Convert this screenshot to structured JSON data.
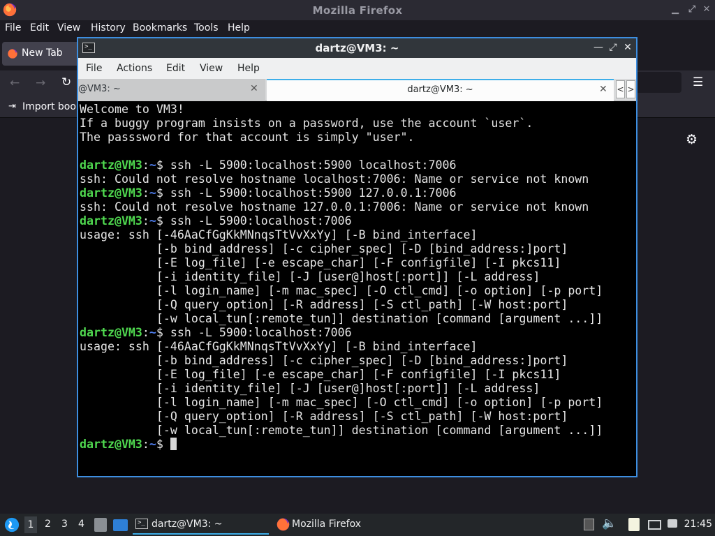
{
  "firefox": {
    "window_title": "Mozilla Firefox",
    "menu": [
      "File",
      "Edit",
      "View",
      "History",
      "Bookmarks",
      "Tools",
      "Help"
    ],
    "tab_title": "New Tab",
    "bookmarks_item": "Import book",
    "colors": {
      "chrome": "#2b2a33",
      "bg": "#1c1b22"
    }
  },
  "terminal": {
    "window_title": "dartz@VM3: ~",
    "menu": [
      "File",
      "Actions",
      "Edit",
      "View",
      "Help"
    ],
    "tabs": [
      {
        "label": "@VM3: ~",
        "active": false
      },
      {
        "label": "dartz@VM3: ~",
        "active": true
      }
    ],
    "prompt": {
      "user": "dartz@VM3",
      "sep": ":",
      "path": "~",
      "symbol": "$ "
    },
    "lines": [
      {
        "type": "text",
        "text": "Welcome to VM3!"
      },
      {
        "type": "text",
        "text": "If a buggy program insists on a password, use the account `user`."
      },
      {
        "type": "text",
        "text": "The passsword for that account is simply \"user\"."
      },
      {
        "type": "text",
        "text": ""
      },
      {
        "type": "prompt",
        "cmd": "ssh -L 5900:localhost:5900 localhost:7006"
      },
      {
        "type": "text",
        "text": "ssh: Could not resolve hostname localhost:7006: Name or service not known"
      },
      {
        "type": "prompt",
        "cmd": "ssh -L 5900:localhost:5900 127.0.0.1:7006"
      },
      {
        "type": "text",
        "text": "ssh: Could not resolve hostname 127.0.0.1:7006: Name or service not known"
      },
      {
        "type": "prompt",
        "cmd": "ssh -L 5900:localhost:7006"
      },
      {
        "type": "text",
        "text": "usage: ssh [-46AaCfGgKkMNnqsTtVvXxYy] [-B bind_interface]"
      },
      {
        "type": "text",
        "text": "           [-b bind_address] [-c cipher_spec] [-D [bind_address:]port]"
      },
      {
        "type": "text",
        "text": "           [-E log_file] [-e escape_char] [-F configfile] [-I pkcs11]"
      },
      {
        "type": "text",
        "text": "           [-i identity_file] [-J [user@]host[:port]] [-L address]"
      },
      {
        "type": "text",
        "text": "           [-l login_name] [-m mac_spec] [-O ctl_cmd] [-o option] [-p port]"
      },
      {
        "type": "text",
        "text": "           [-Q query_option] [-R address] [-S ctl_path] [-W host:port]"
      },
      {
        "type": "text",
        "text": "           [-w local_tun[:remote_tun]] destination [command [argument ...]]"
      },
      {
        "type": "prompt",
        "cmd": "ssh -L 5900:localhost:7006"
      },
      {
        "type": "text",
        "text": "usage: ssh [-46AaCfGgKkMNnqsTtVvXxYy] [-B bind_interface]"
      },
      {
        "type": "text",
        "text": "           [-b bind_address] [-c cipher_spec] [-D [bind_address:]port]"
      },
      {
        "type": "text",
        "text": "           [-E log_file] [-e escape_char] [-F configfile] [-I pkcs11]"
      },
      {
        "type": "text",
        "text": "           [-i identity_file] [-J [user@]host[:port]] [-L address]"
      },
      {
        "type": "text",
        "text": "           [-l login_name] [-m mac_spec] [-O ctl_cmd] [-o option] [-p port]"
      },
      {
        "type": "text",
        "text": "           [-Q query_option] [-R address] [-S ctl_path] [-W host:port]"
      },
      {
        "type": "text",
        "text": "           [-w local_tun[:remote_tun]] destination [command [argument ...]]"
      },
      {
        "type": "prompt",
        "cmd": "",
        "cursor": true
      }
    ],
    "colors": {
      "user": "#4fd84f",
      "path": "#4f7ff0",
      "text": "#e5e5e5",
      "bg": "#000000",
      "accent": "#3d8ee0"
    }
  },
  "taskbar": {
    "workspaces": [
      "1",
      "2",
      "3",
      "4"
    ],
    "active_workspace": "1",
    "tasks": [
      {
        "label": "dartz@VM3: ~",
        "icon": "terminal-icon",
        "active": true
      },
      {
        "label": "Mozilla Firefox",
        "icon": "firefox-icon",
        "active": false
      }
    ],
    "tray_icons": [
      "clipboard-icon",
      "volume-icon",
      "notes-icon",
      "network-icon"
    ],
    "clock": "21:45"
  }
}
